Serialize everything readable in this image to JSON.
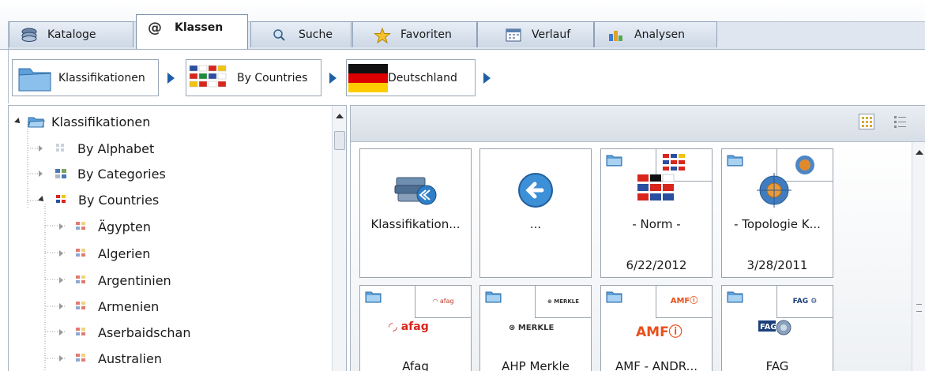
{
  "tabs": [
    {
      "label": "Kataloge",
      "icon": "catalog-stack-icon"
    },
    {
      "label": "Klassen",
      "icon": "at-sign-icon",
      "active": true
    },
    {
      "label": "Suche",
      "icon": "magnifier-icon"
    },
    {
      "label": "Favoriten",
      "icon": "star-icon"
    },
    {
      "label": "Verlauf",
      "icon": "calendar-icon"
    },
    {
      "label": "Analysen",
      "icon": "bar-chart-icon"
    }
  ],
  "breadcrumb": [
    {
      "label": "Klassifikationen",
      "icon": "folder-icon"
    },
    {
      "label": "By Countries",
      "icon": "flags-grid-icon"
    },
    {
      "label": "Deutschland",
      "icon": "german-flag-icon"
    }
  ],
  "tree": {
    "root": "Klassifikationen",
    "items": [
      {
        "label": "By Alphabet",
        "level": 1
      },
      {
        "label": "By Categories",
        "level": 1
      },
      {
        "label": "By Countries",
        "level": 1,
        "expanded": true
      },
      {
        "label": "Ägypten",
        "level": 2
      },
      {
        "label": "Algerien",
        "level": 2
      },
      {
        "label": "Argentinien",
        "level": 2
      },
      {
        "label": "Armenien",
        "level": 2
      },
      {
        "label": "Aserbaidschan",
        "level": 2
      },
      {
        "label": "Australien",
        "level": 2
      }
    ]
  },
  "cards": [
    {
      "name": "Klassifikation...",
      "date": ""
    },
    {
      "name": "...",
      "date": ""
    },
    {
      "name": "- Norm -",
      "date": "6/22/2012"
    },
    {
      "name": "- Topologie K...",
      "date": "3/28/2011"
    },
    {
      "name": "Afag",
      "date": "",
      "logo": "afag"
    },
    {
      "name": "AHP Merkle",
      "date": "",
      "logo": "MERKLE"
    },
    {
      "name": "AMF - ANDR...",
      "date": "",
      "logo": "AMF"
    },
    {
      "name": "FAG",
      "date": "",
      "logo": "FAG"
    }
  ],
  "colors": {
    "accent": "#1b5fa8",
    "tab_border": "#8ea0b8"
  }
}
